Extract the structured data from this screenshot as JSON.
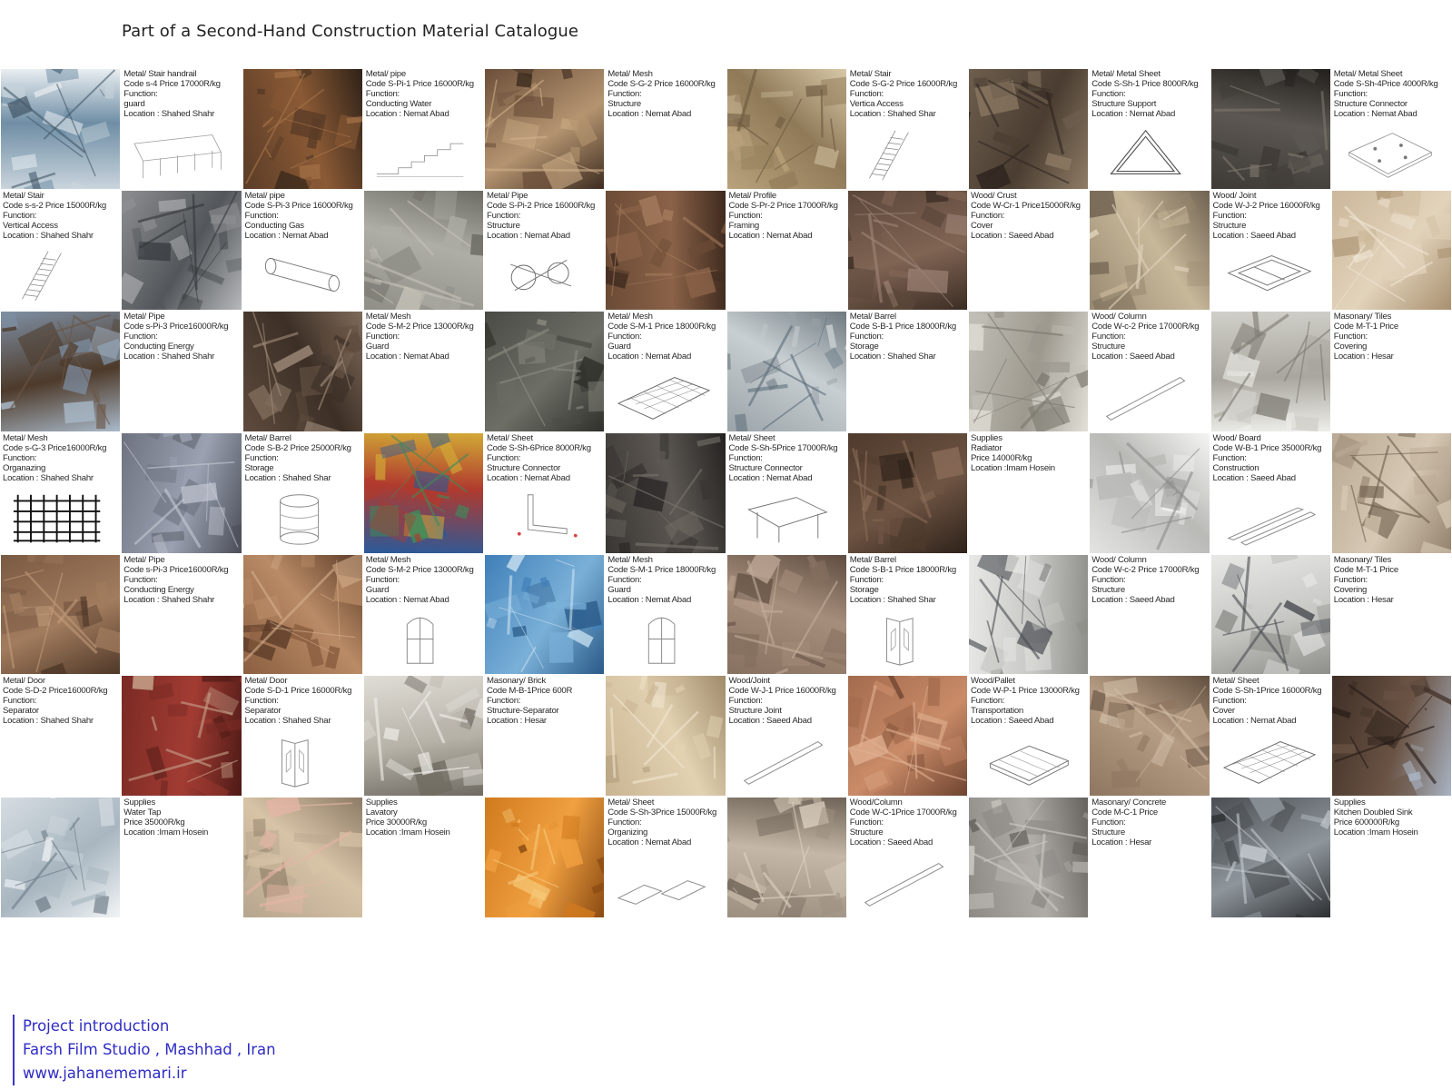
{
  "title": "Part of a Second-Hand Construction Material Catalogue",
  "footer": {
    "line1": "Project introduction",
    "line2": "Farsh Film Studio , Mashhad , Iran",
    "line3": "www.jahanememari.ir"
  },
  "photo_palettes": {
    "stair-rack": [
      "#c9d4dc",
      "#6f8ea5",
      "#e9eef1",
      "#44596a"
    ],
    "pipes-rust": [
      "#5a3c27",
      "#8b5a35",
      "#2f2218",
      "#a8764a"
    ],
    "mesh-rust": [
      "#6c4f3a",
      "#b49470",
      "#3e2c20",
      "#cfb08a"
    ],
    "timber-pile": [
      "#b9a27c",
      "#8f7a58",
      "#d8c8a8",
      "#6d5a40"
    ],
    "metal-scrap": [
      "#6e5e4e",
      "#4a3d31",
      "#8f7c66",
      "#2f2620"
    ],
    "sheet-stack": [
      "#3e3a36",
      "#5c5752",
      "#221f1c",
      "#7d766d"
    ],
    "ladder": [
      "#8d8f91",
      "#53575b",
      "#b6b8ba",
      "#33363a"
    ],
    "pipes-grey": [
      "#8f8f88",
      "#aeaea6",
      "#6c6b64",
      "#c7c3b8"
    ],
    "fence-wood": [
      "#6b4b36",
      "#8a6248",
      "#3f2b1f",
      "#a47b5c"
    ],
    "profile-wood": [
      "#5b473a",
      "#806454",
      "#3b2d24",
      "#9e8577"
    ],
    "crust-pile": [
      "#9a8a72",
      "#c8b89a",
      "#6f6250",
      "#e0d4bc"
    ],
    "light-wood": [
      "#cbb79a",
      "#e2d3bb",
      "#a8906f",
      "#f1e7d6"
    ],
    "pipes-sky": [
      "#7e8fa3",
      "#4d3a2a",
      "#a9b9c9",
      "#6a5443"
    ],
    "iron-gate": [
      "#5e4b3d",
      "#3c2f26",
      "#806b5a",
      "#a18d7b"
    ],
    "chain-link": [
      "#4a4b45",
      "#6d6e66",
      "#2f302b",
      "#8c8c83"
    ],
    "tanks": [
      "#9aa3a8",
      "#c8cfd2",
      "#6f7a80",
      "#5a6b78"
    ],
    "stone-blocks": [
      "#c2bfb6",
      "#9d998f",
      "#e3e0d8",
      "#7b776e"
    ],
    "tile-pile": [
      "#d0cfc9",
      "#a8a69e",
      "#eeeeea",
      "#7c7a72"
    ],
    "grid-mesh": [
      "#6e7280",
      "#9ba1b1",
      "#4a4d57",
      "#c5c9d4"
    ],
    "barrels": [
      "#2a5a9a",
      "#b03a2e",
      "#d2aa36",
      "#3f8a5a"
    ],
    "angle-iron": [
      "#3a3633",
      "#5d5853",
      "#242120",
      "#7a746c"
    ],
    "scaffold": [
      "#4e3a2c",
      "#6e5443",
      "#2e221a",
      "#8a6c58"
    ],
    "radiators": [
      "#e4e4e2",
      "#b9b9b6",
      "#f5f5f3",
      "#8d8d8a"
    ],
    "plank-rack": [
      "#b8a894",
      "#d6c8b4",
      "#93826d",
      "#6d5e4c"
    ],
    "lumber-yard": [
      "#7a5a43",
      "#a27c5e",
      "#4e3828",
      "#c09a7a"
    ],
    "window-frames": [
      "#8a5e40",
      "#b98b66",
      "#5b3b27",
      "#d6b08e"
    ],
    "blue-doors": [
      "#3f7fb8",
      "#7ab0d8",
      "#2a5a88",
      "#c9e0ef"
    ],
    "brown-doors": [
      "#86705f",
      "#a68e7c",
      "#5f4d40",
      "#c2ac9a"
    ],
    "sinks": [
      "#e8e8e6",
      "#c7c7c4",
      "#8e8e8a",
      "#4a4d52"
    ],
    "door-red": [
      "#7a2a24",
      "#a23c33",
      "#4e1a16",
      "#c6a38c"
    ],
    "door-white": [
      "#e0ddd6",
      "#b7b2a8",
      "#6f6a61",
      "#f2f0ec"
    ],
    "rubble": [
      "#c9b492",
      "#e2d2b2",
      "#a08b6a",
      "#f0e6d0"
    ],
    "pallets": [
      "#a36b4e",
      "#c98b68",
      "#6f4430",
      "#e0b090"
    ],
    "pallet-stack": [
      "#8e7660",
      "#b59c84",
      "#62503f",
      "#d0bca6"
    ],
    "blue-sky-rack": [
      "#3f2f26",
      "#6a5344",
      "#a8b3c2",
      "#231a15"
    ],
    "tap": [
      "#d6dde2",
      "#a8b6c0",
      "#f1f4f6",
      "#6d7b86"
    ],
    "basins": [
      "#b6a58e",
      "#d7c3a6",
      "#8d7b66",
      "#e7b6a6"
    ],
    "orange-shelves": [
      "#d07a1e",
      "#f0a040",
      "#8a4a12",
      "#f6c97a"
    ],
    "logs-cut": [
      "#9c8f80",
      "#c4b7a6",
      "#6f6458",
      "#ddd2c2"
    ],
    "concrete": [
      "#8d8a86",
      "#b0ada8",
      "#65625e",
      "#cfccc6"
    ],
    "steel-sink": [
      "#4a4e52",
      "#8e959b",
      "#2c2f32",
      "#c3c9ce"
    ]
  },
  "catalogue": [
    {
      "type": "photo",
      "palette": "stair-rack"
    },
    {
      "type": "info",
      "lines": [
        "Metal/ Stair handrail",
        "Code   s-4    Price  17000R/kg",
        "Function:",
        "guard",
        "Location : Shahed Shahr"
      ],
      "drawing": "handrail"
    },
    {
      "type": "photo",
      "palette": "pipes-rust"
    },
    {
      "type": "info",
      "lines": [
        "Metal/ pipe",
        "Code S-Pi-1 Price  16000R/kg",
        "Function:",
        "Conducting Water",
        "Location : Nemat Abad"
      ],
      "drawing": "steps"
    },
    {
      "type": "photo",
      "palette": "mesh-rust"
    },
    {
      "type": "info",
      "lines": [
        "Metal/ Mesh",
        "Code S-G-2  Price  16000R/kg",
        "Function:",
        "Structure",
        "Location : Nemat Abad"
      ],
      "drawing": ""
    },
    {
      "type": "photo",
      "palette": "timber-pile"
    },
    {
      "type": "info",
      "lines": [
        "Metal/ Stair",
        "Code S-G-2  Price  16000R/kg",
        "Function:",
        "Vertica Access",
        "Location : Shahed Shar"
      ],
      "drawing": "stair"
    },
    {
      "type": "photo",
      "palette": "metal-scrap"
    },
    {
      "type": "info",
      "lines": [
        "Metal/ Metal Sheet",
        "Code S-Sh-1 Price  8000R/kg",
        "Function:",
        "Structure Support",
        "Location : Nemat Abad"
      ],
      "drawing": "triangle"
    },
    {
      "type": "photo",
      "palette": "sheet-stack"
    },
    {
      "type": "info",
      "lines": [
        "Metal/ Metal Sheet",
        "Code S-Sh-4Price  4000R/kg",
        "Function:",
        "Structure Connector",
        "Location : Nemat Abad"
      ],
      "drawing": "plate"
    },
    {
      "type": "info",
      "lines": [
        "Metal/ Stair",
        "Code   s-s-2  Price 15000R/kg",
        "Function:",
        "Vertical Access",
        "Location : Shahed Shahr"
      ],
      "drawing": "stair"
    },
    {
      "type": "photo",
      "palette": "ladder"
    },
    {
      "type": "info",
      "lines": [
        "Metal/ pipe",
        "Code S-Pi-3  Price  16000R/kg",
        "Function:",
        "Conducting Gas",
        "Location : Nemat Abad"
      ],
      "drawing": "pipe"
    },
    {
      "type": "photo",
      "palette": "pipes-grey"
    },
    {
      "type": "info",
      "lines": [
        "Metal/ Pipe",
        "Code S-Pi-2  Price  16000R/kg",
        "Function:",
        "Structure",
        "Location : Nemat Abad"
      ],
      "drawing": "clamp"
    },
    {
      "type": "photo",
      "palette": "fence-wood"
    },
    {
      "type": "info",
      "lines": [
        "Metal/ Profile",
        "Code S-Pr-2 Price  17000R/kg",
        "Function:",
        "Framing",
        "Location : Nemat Abad"
      ],
      "drawing": ""
    },
    {
      "type": "photo",
      "palette": "profile-wood"
    },
    {
      "type": "info",
      "lines": [
        "Wood/ Crust",
        "Code W-Cr-1 Price15000R/kg",
        "Function:",
        "Cover",
        "Location : Saeed Abad"
      ],
      "drawing": ""
    },
    {
      "type": "photo",
      "palette": "crust-pile"
    },
    {
      "type": "info",
      "lines": [
        "Wood/ Joint",
        "Code W-J-2  Price  16000R/kg",
        "Function:",
        "Structure",
        "Location : Saeed Abad"
      ],
      "drawing": "frame"
    },
    {
      "type": "photo",
      "palette": "light-wood"
    },
    {
      "type": "photo",
      "palette": "pipes-sky"
    },
    {
      "type": "info",
      "lines": [
        "Metal/ Pipe",
        "Code    s-Pi-3 Price16000R/kg",
        "Function:",
        "Conducting Energy",
        "Location : Shahed Shahr"
      ],
      "drawing": ""
    },
    {
      "type": "photo",
      "palette": "iron-gate"
    },
    {
      "type": "info",
      "lines": [
        "Metal/ Mesh",
        "Code S-M-2 Price  13000R/kg",
        "Function:",
        "Guard",
        "Location : Nemat Abad"
      ],
      "drawing": ""
    },
    {
      "type": "photo",
      "palette": "chain-link"
    },
    {
      "type": "info",
      "lines": [
        "Metal/ Mesh",
        "Code S-M-1 Price  18000R/kg",
        "Function:",
        "Guard",
        "Location : Nemat Abad"
      ],
      "drawing": "mesh"
    },
    {
      "type": "photo",
      "palette": "tanks"
    },
    {
      "type": "info",
      "lines": [
        "Metal/ Barrel",
        "Code S-B-1  Price  18000R/kg",
        "Function:",
        "Storage",
        "Location : Shahed Shar"
      ],
      "drawing": ""
    },
    {
      "type": "photo",
      "palette": "stone-blocks"
    },
    {
      "type": "info",
      "lines": [
        "Wood/ Column",
        "Code W-c-2  Price  17000R/kg",
        "Function:",
        "Structure",
        "Location : Saeed Abad"
      ],
      "drawing": "beam"
    },
    {
      "type": "photo",
      "palette": "tile-pile"
    },
    {
      "type": "info",
      "lines": [
        "Masonary/ Tiles",
        "Code M-T-1 Price",
        "Function:",
        "Covering",
        "Location : Hesar"
      ],
      "drawing": ""
    },
    {
      "type": "info",
      "lines": [
        "Metal/ Mesh",
        "Code    s-G-3  Price16000R/kg",
        "Function:",
        "Organazing",
        "Location : Shahed Shahr"
      ],
      "drawing": "grid"
    },
    {
      "type": "photo",
      "palette": "grid-mesh"
    },
    {
      "type": "info",
      "lines": [
        "Metal/ Barrel",
        "Code S-B-2  Price  25000R/kg",
        "Function:",
        "Storage",
        "Location : Shahed Shar"
      ],
      "drawing": "barrel"
    },
    {
      "type": "photo",
      "palette": "barrels"
    },
    {
      "type": "info",
      "lines": [
        "Metal/ Sheet",
        "Code S-Sh-6Price  8000R/kg",
        "Function:",
        "Structure Connector",
        "Location : Nemat Abad"
      ],
      "drawing": "angle"
    },
    {
      "type": "photo",
      "palette": "angle-iron"
    },
    {
      "type": "info",
      "lines": [
        "Metal/ Sheet",
        "Code S-Sh-5Price  17000R/kg",
        "Function:",
        "Structure Connector",
        "Location : Nemat Abad"
      ],
      "drawing": "table"
    },
    {
      "type": "photo",
      "palette": "scaffold"
    },
    {
      "type": "info",
      "lines": [
        "Supplies",
        "Radiator",
        "Price    14000R/kg",
        "Location :Imam Hosein"
      ],
      "drawing": ""
    },
    {
      "type": "photo",
      "palette": "radiators"
    },
    {
      "type": "info",
      "lines": [
        "Wood/ Board",
        "Code W-B-1 Price  35000R/kg",
        "Function:",
        "Construction",
        "Location : Saeed Abad"
      ],
      "drawing": "boards"
    },
    {
      "type": "photo",
      "palette": "plank-rack"
    },
    {
      "type": "photo",
      "palette": "lumber-yard"
    },
    {
      "type": "info",
      "lines": [
        "Metal/ Pipe",
        "Code    s-Pi-3 Price16000R/kg",
        "Function:",
        "Conducting Energy",
        "Location : Shahed Shahr"
      ],
      "drawing": ""
    },
    {
      "type": "photo",
      "palette": "window-frames"
    },
    {
      "type": "info",
      "lines": [
        "Metal/ Mesh",
        "Code S-M-2 Price  13000R/kg",
        "Function:",
        "Guard",
        "Location : Nemat Abad"
      ],
      "drawing": "window"
    },
    {
      "type": "photo",
      "palette": "blue-doors"
    },
    {
      "type": "info",
      "lines": [
        "Metal/ Mesh",
        "Code S-M-1 Price  18000R/kg",
        "Function:",
        "Guard",
        "Location : Nemat Abad"
      ],
      "drawing": "window"
    },
    {
      "type": "photo",
      "palette": "brown-doors"
    },
    {
      "type": "info",
      "lines": [
        "Metal/ Barrel",
        "Code S-B-1  Price  18000R/kg",
        "Function:",
        "Storage",
        "Location : Shahed Shar"
      ],
      "drawing": "door"
    },
    {
      "type": "photo",
      "palette": "sinks"
    },
    {
      "type": "info",
      "lines": [
        "Wood/ Column",
        "Code W-c-2  Price  17000R/kg",
        "Function:",
        "Structure",
        "Location : Saeed Abad"
      ],
      "drawing": ""
    },
    {
      "type": "photo",
      "palette": "sinks"
    },
    {
      "type": "info",
      "lines": [
        "Masonary/ Tiles",
        "Code M-T-1 Price",
        "Function:",
        "Covering",
        "Location : Hesar"
      ],
      "drawing": ""
    },
    {
      "type": "info",
      "lines": [
        "Metal/ Door",
        "Code   S-D-2  Price16000R/kg",
        "Function:",
        "Separator",
        "Location : Shahed Shahr"
      ],
      "drawing": ""
    },
    {
      "type": "photo",
      "palette": "door-red"
    },
    {
      "type": "info",
      "lines": [
        "Metal/ Door",
        "Code S-D-1  Price  16000R/kg",
        "Function:",
        "Separator",
        "Location : Shahed Shar"
      ],
      "drawing": "door"
    },
    {
      "type": "photo",
      "palette": "door-white"
    },
    {
      "type": "info",
      "lines": [
        "Masonary/ Brick",
        "Code M-B-1Price  600R",
        "Function:",
        "Structure-Separator",
        "Location : Hesar"
      ],
      "drawing": ""
    },
    {
      "type": "photo",
      "palette": "rubble"
    },
    {
      "type": "info",
      "lines": [
        "Wood/Joint",
        "Code W-J-1  Price  16000R/kg",
        "Function:",
        "Structure Joint",
        "Location : Saeed Abad"
      ],
      "drawing": "beam"
    },
    {
      "type": "photo",
      "palette": "pallets"
    },
    {
      "type": "info",
      "lines": [
        "Wood/Pallet",
        "Code W-P-1 Price  13000R/kg",
        "Function:",
        "Transportation",
        "Location : Saeed Abad"
      ],
      "drawing": "pallet"
    },
    {
      "type": "photo",
      "palette": "pallet-stack"
    },
    {
      "type": "info",
      "lines": [
        "Metal/ Sheet",
        "Code S-Sh-1Price  16000R/kg",
        "Function:",
        "Cover",
        "Location : Nemat Abad"
      ],
      "drawing": "mesh"
    },
    {
      "type": "photo",
      "palette": "blue-sky-rack"
    },
    {
      "type": "photo",
      "palette": "tap"
    },
    {
      "type": "info",
      "lines": [
        "Supplies",
        "Water Tap",
        "Price     35000R/kg",
        "Location :Imam Hosein"
      ],
      "drawing": ""
    },
    {
      "type": "photo",
      "palette": "basins"
    },
    {
      "type": "info",
      "lines": [
        "Supplies",
        "Lavatory",
        "Price    30000R/kg",
        "Location :Imam Hosein"
      ],
      "drawing": ""
    },
    {
      "type": "photo",
      "palette": "orange-shelves"
    },
    {
      "type": "info",
      "lines": [
        "Metal/ Sheet",
        "Code S-Sh-3Price  15000R/kg",
        "Function:",
        "Organizing",
        "Location : Nemat Abad"
      ],
      "drawing": "trays"
    },
    {
      "type": "photo",
      "palette": "logs-cut"
    },
    {
      "type": "info",
      "lines": [
        "Wood/Column",
        "Code W-C-1Price  17000R/kg",
        "Function:",
        "Structure",
        "Location : Saeed Abad"
      ],
      "drawing": "beam"
    },
    {
      "type": "photo",
      "palette": "concrete"
    },
    {
      "type": "info",
      "lines": [
        "Masonary/ Concrete",
        "Code M-C-1 Price",
        "Function:",
        "Structure",
        "Location : Hesar"
      ],
      "drawing": ""
    },
    {
      "type": "photo",
      "palette": "steel-sink"
    },
    {
      "type": "info",
      "lines": [
        "Supplies",
        "Kitchen Doubled Sink",
        "Price     600000R/kg",
        "Location :Imam Hosein"
      ],
      "drawing": ""
    }
  ]
}
